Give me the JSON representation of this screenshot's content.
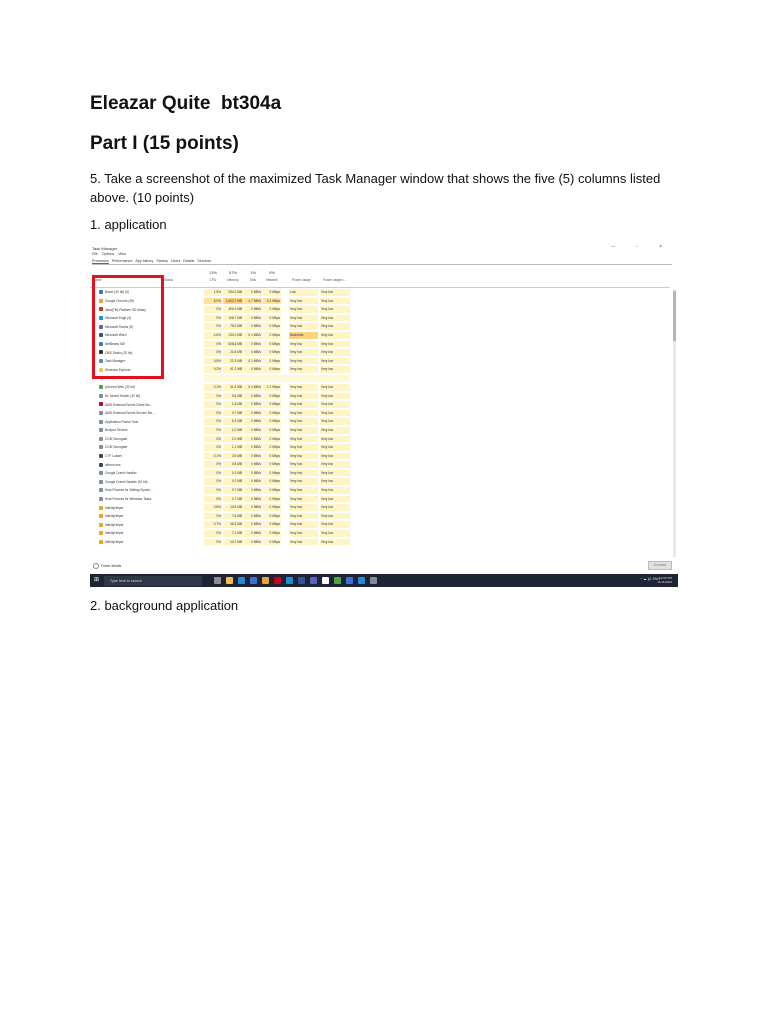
{
  "document": {
    "title": "Eleazar Quite  bt304a",
    "part": "Part I (15 points)",
    "instruction": "5. Take a screenshot of the maximized Task Manager window that shows the five (5) columns listed above. (10 points)",
    "label_application": "1. application",
    "label_background": "2. background application"
  },
  "task_manager": {
    "window_title": "Task Manager",
    "window_controls": "–  ▫  ×",
    "menu": [
      "File",
      "Options",
      "View"
    ],
    "tabs": [
      "Processes",
      "Performance",
      "App history",
      "Startup",
      "Users",
      "Details",
      "Services"
    ],
    "columns": {
      "name": "Name",
      "status": "Status",
      "cpu_pct": "13%",
      "cpu": "CPU",
      "mem_pct": "57%",
      "mem": "Memory",
      "disk_pct": "1%",
      "disk": "Disk",
      "net_pct": "0%",
      "net": "Network",
      "power": "Power usage",
      "power_trend": "Power usage t..."
    },
    "apps": [
      {
        "name": "Brave (32 bit) (6)",
        "cpu": "1.5%",
        "mem": "254.3 MB",
        "disk": "0 MB/s",
        "net": "0 Mbps",
        "power": "Low",
        "trend": "Very low",
        "icon_color": "#3b6fd8"
      },
      {
        "name": "Google Chrome (39)",
        "cpu": "8.0%",
        "mem": "1,062.1 MB",
        "disk": "4.7 MB/s",
        "net": "0.1 Mbps",
        "power": "Very low",
        "trend": "Very low",
        "icon_color": "#e8a13a",
        "hot": true
      },
      {
        "name": "Java(TM) Platform SE binary",
        "cpu": "0%",
        "mem": "300.4 MB",
        "disk": "0 MB/s",
        "net": "0 Mbps",
        "power": "Very low",
        "trend": "Very low",
        "icon_color": "#c0392b"
      },
      {
        "name": "Microsoft Edge (4)",
        "cpu": "0%",
        "mem": "106.7 MB",
        "disk": "0 MB/s",
        "net": "0 Mbps",
        "power": "Very low",
        "trend": "Very low",
        "icon_color": "#1b8fd6"
      },
      {
        "name": "Microsoft Teams (5)",
        "cpu": "0%",
        "mem": "75.2 MB",
        "disk": "0 MB/s",
        "net": "0 Mbps",
        "power": "Very low",
        "trend": "Very low",
        "icon_color": "#5b5fc7"
      },
      {
        "name": "Microsoft Word",
        "cpu": "4.6%",
        "mem": "134.1 MB",
        "disk": "0.1 MB/s",
        "net": "0 Mbps",
        "power": "Moderate",
        "trend": "Very low",
        "icon_color": "#2b579a"
      },
      {
        "name": "NetBeans IDE",
        "cpu": "0%",
        "mem": "608.8 MB",
        "disk": "0 MB/s",
        "net": "0 Mbps",
        "power": "Very low",
        "trend": "Very low",
        "icon_color": "#2f7fc1"
      },
      {
        "name": "OBS Studio (32 bit)",
        "cpu": "0%",
        "mem": "21.8 MB",
        "disk": "0 MB/s",
        "net": "0 Mbps",
        "power": "Very low",
        "trend": "Very low",
        "icon_color": "#333333"
      },
      {
        "name": "Task Manager",
        "cpu": "0.5%",
        "mem": "22.3 MB",
        "disk": "0.1 MB/s",
        "net": "0 Mbps",
        "power": "Very low",
        "trend": "Very low",
        "icon_color": "#4a90c8"
      },
      {
        "name": "Windows Explorer",
        "cpu": "0.2%",
        "mem": "41.2 MB",
        "disk": "0 MB/s",
        "net": "0 Mbps",
        "power": "Very low",
        "trend": "Very low",
        "icon_color": "#f2c14e"
      }
    ],
    "background_header": "Background processes (53)",
    "background": [
      {
        "name": "µTorrent Web (32 bit)",
        "cpu": "0.1%",
        "mem": "31.8 MB",
        "disk": "0.4 MB/s",
        "net": "1.2 Mbps",
        "power": "Very low",
        "trend": "Very low",
        "icon_color": "#52a347"
      },
      {
        "name": "8x Torrent Helper (32 bit)",
        "cpu": "0%",
        "mem": "5.6 MB",
        "disk": "0 MB/s",
        "net": "0 Mbps",
        "power": "Very low",
        "trend": "Very low",
        "icon_color": "#7f8c99"
      },
      {
        "name": "AMD External Events Client Mo...",
        "cpu": "0%",
        "mem": "1.8 MB",
        "disk": "0 MB/s",
        "net": "0 Mbps",
        "power": "Very low",
        "trend": "Very low",
        "icon_color": "#d0021b"
      },
      {
        "name": "AMD External Events Service Mo...",
        "cpu": "0%",
        "mem": "0.7 MB",
        "disk": "0 MB/s",
        "net": "0 Mbps",
        "power": "Very low",
        "trend": "Very low",
        "icon_color": "#7f8c99"
      },
      {
        "name": "Application Frame Host",
        "cpu": "0%",
        "mem": "5.3 MB",
        "disk": "0 MB/s",
        "net": "0 Mbps",
        "power": "Very low",
        "trend": "Very low",
        "icon_color": "#7f8c99"
      },
      {
        "name": "Bonjour Service",
        "cpu": "0%",
        "mem": "1.0 MB",
        "disk": "0 MB/s",
        "net": "0 Mbps",
        "power": "Very low",
        "trend": "Very low",
        "icon_color": "#7f8c99"
      },
      {
        "name": "COM Surrogate",
        "cpu": "0%",
        "mem": "2.0 MB",
        "disk": "0 MB/s",
        "net": "0 Mbps",
        "power": "Very low",
        "trend": "Very low",
        "icon_color": "#7f8c99"
      },
      {
        "name": "COM Surrogate",
        "cpu": "0%",
        "mem": "1.1 MB",
        "disk": "0 MB/s",
        "net": "0 Mbps",
        "power": "Very low",
        "trend": "Very low",
        "icon_color": "#7f8c99"
      },
      {
        "name": "CTF Loader",
        "cpu": "0.1%",
        "mem": "3.9 MB",
        "disk": "0 MB/s",
        "net": "0 Mbps",
        "power": "Very low",
        "trend": "Very low",
        "icon_color": "#3c4a5c"
      },
      {
        "name": "ctfmon.exe",
        "cpu": "0%",
        "mem": "0.8 MB",
        "disk": "0 MB/s",
        "net": "0 Mbps",
        "power": "Very low",
        "trend": "Very low",
        "icon_color": "#3c4a5c"
      },
      {
        "name": "Google Crash Handler",
        "cpu": "0%",
        "mem": "0.3 MB",
        "disk": "0 MB/s",
        "net": "0 Mbps",
        "power": "Very low",
        "trend": "Very low",
        "icon_color": "#7f8c99"
      },
      {
        "name": "Google Crash Handler (32 bit)",
        "cpu": "0%",
        "mem": "0.2 MB",
        "disk": "0 MB/s",
        "net": "0 Mbps",
        "power": "Very low",
        "trend": "Very low",
        "icon_color": "#7f8c99"
      },
      {
        "name": "Host Process for Setting Synchr...",
        "cpu": "0%",
        "mem": "0.7 MB",
        "disk": "0 MB/s",
        "net": "0 Mbps",
        "power": "Very low",
        "trend": "Very low",
        "icon_color": "#7f8c99"
      },
      {
        "name": "Host Process for Windows Tasks",
        "cpu": "0%",
        "mem": "2.7 MB",
        "disk": "0 MB/s",
        "net": "0 Mbps",
        "power": "Very low",
        "trend": "Very low",
        "icon_color": "#7f8c99"
      },
      {
        "name": "InfinityHelper",
        "cpu": "0.8%",
        "mem": "10.8 MB",
        "disk": "0 MB/s",
        "net": "0 Mbps",
        "power": "Very low",
        "trend": "Very low",
        "icon_color": "#e6a817"
      },
      {
        "name": "InfinityHelper",
        "cpu": "0%",
        "mem": "7.6 MB",
        "disk": "0 MB/s",
        "net": "0 Mbps",
        "power": "Very low",
        "trend": "Very low",
        "icon_color": "#e6a817"
      },
      {
        "name": "InfinityHelper",
        "cpu": "0.7%",
        "mem": "46.3 MB",
        "disk": "0 MB/s",
        "net": "0 Mbps",
        "power": "Very low",
        "trend": "Very low",
        "icon_color": "#e6a817"
      },
      {
        "name": "InfinityHelper",
        "cpu": "0%",
        "mem": "7.1 MB",
        "disk": "0 MB/s",
        "net": "0 Mbps",
        "power": "Very low",
        "trend": "Very low",
        "icon_color": "#e6a817"
      },
      {
        "name": "InfinityHelper",
        "cpu": "0%",
        "mem": "10.2 MB",
        "disk": "0 MB/s",
        "net": "0 Mbps",
        "power": "Very low",
        "trend": "Very low",
        "icon_color": "#e6a817"
      }
    ],
    "fewer_details": "Fewer details",
    "end_task": "End task",
    "taskbar": {
      "search_placeholder": "Type here to search",
      "app_colors": [
        "#8e8e8e",
        "#f2c14e",
        "#1b8fd6",
        "#3b6fd8",
        "#e8a13a",
        "#d0021b",
        "#1b8fd6",
        "#2b579a",
        "#5b5fc7",
        "#ffffff",
        "#52a347",
        "#3b6fd8",
        "#1b8fd6",
        "#7f8c99"
      ],
      "tray": "^ ☁ 🔊 ENG",
      "time": "12:00 PM",
      "date": "11/11/2022"
    },
    "highlight_color": "#e0121e"
  }
}
